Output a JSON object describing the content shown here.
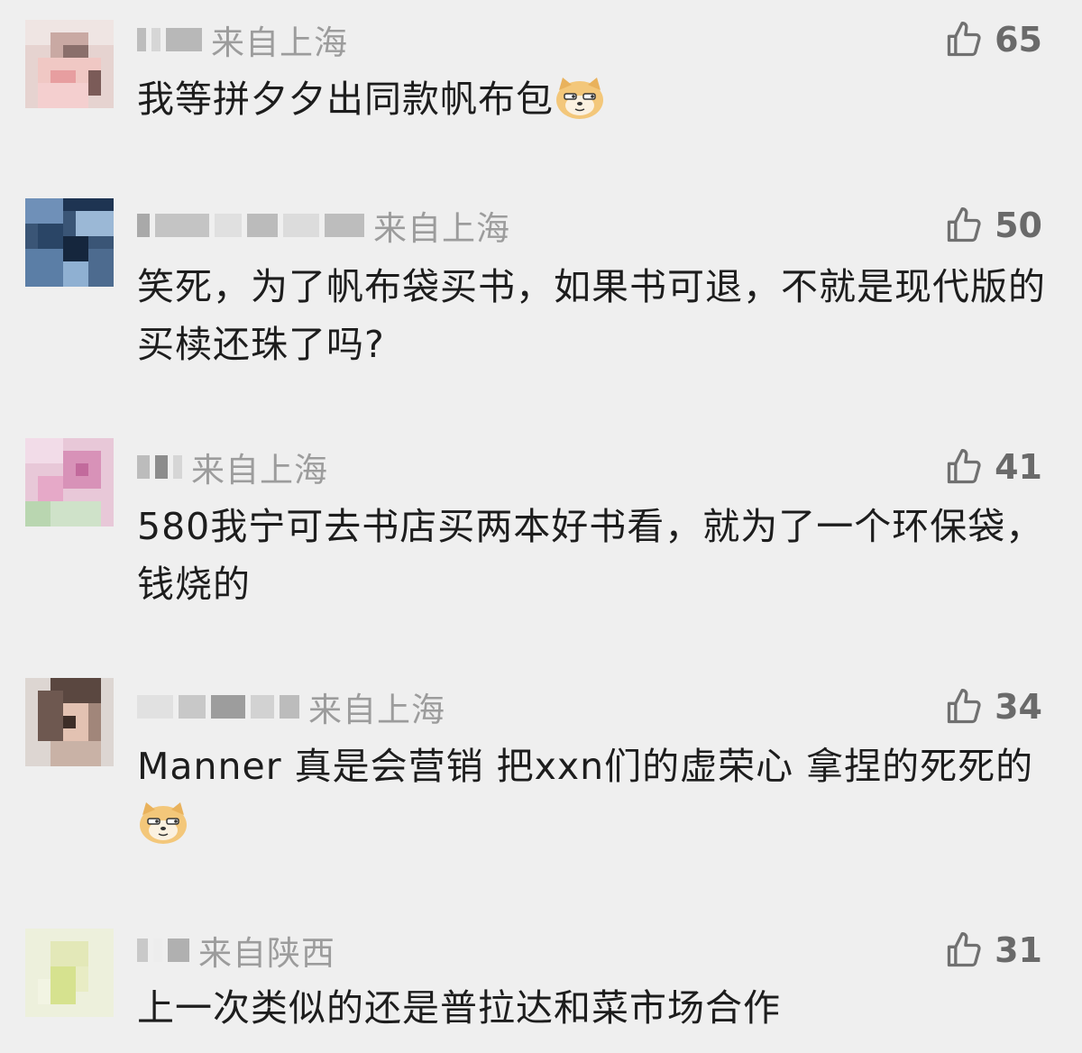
{
  "comments": [
    {
      "location": "来自上海",
      "likes": "65",
      "text": "我等拼夕夕出同款帆布包",
      "emoji": "doge-emoji"
    },
    {
      "location": "来自上海",
      "likes": "50",
      "text": "笑死，为了帆布袋买书，如果书可退，不就是现代版的买椟还珠了吗?"
    },
    {
      "location": "来自上海",
      "likes": "41",
      "text": "580我宁可去书店买两本好书看，就为了一个环保袋，钱烧的"
    },
    {
      "location": "来自上海",
      "likes": "34",
      "text": "Manner 真是会营销 把xxn们的虚荣心 拿捏的死死的",
      "emoji": "doge-emoji"
    },
    {
      "location": "来自陕西",
      "likes": "31",
      "text": "上一次类似的还是普拉达和菜市场合作"
    }
  ],
  "colors": {
    "background": "#efefef",
    "location_text": "#9c9c9c",
    "like_icon": "#6e6e6e",
    "comment_text": "#1d1d1d"
  },
  "icons": [
    "thumbs-up-icon",
    "doge-emoji"
  ]
}
